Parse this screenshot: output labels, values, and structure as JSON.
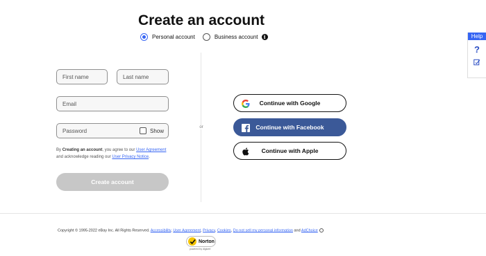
{
  "header": {
    "title": "Create an account"
  },
  "account_type": {
    "personal_label": "Personal account",
    "business_label": "Business account",
    "selected": "Personal account"
  },
  "form": {
    "first_name_placeholder": "First name",
    "last_name_placeholder": "Last name",
    "email_placeholder": "Email",
    "password_placeholder": "Password",
    "show_label": "Show",
    "legal": {
      "prefix": "By",
      "bold": "Creating an account",
      "mid1": ", you agree to our",
      "link1": "User Agreement",
      "mid2": "and acknowledge reading our",
      "link2": "User Privacy Notice",
      "suffix": "."
    },
    "submit_label": "Create account"
  },
  "divider": {
    "or_label": "or"
  },
  "social": {
    "google_label": "Continue with Google",
    "facebook_label": "Continue with Facebook",
    "apple_label": "Continue with Apple"
  },
  "help_panel": {
    "label": "Help",
    "question_glyph": "?"
  },
  "footer": {
    "copyright": "Copyright © 1995-2022 eBay Inc. All Rights Reserved.",
    "links": [
      "Accessibility",
      "User Agreement",
      "Privacy",
      "Cookies",
      "Do not sell my personal information"
    ],
    "and_label": "and",
    "adchoice": "AdChoice"
  },
  "badge": {
    "name": "Norton",
    "sub": "powered by digicert"
  },
  "colors": {
    "primary_blue": "#3665f3",
    "facebook_blue": "#3b5998",
    "disabled_gray": "#c7c7c7",
    "norton_yellow": "#f4c400"
  },
  "icons": [
    "info-icon",
    "google-icon",
    "facebook-icon",
    "apple-icon",
    "help-question-icon",
    "feedback-icon",
    "adchoice-icon",
    "norton-check-icon"
  ]
}
